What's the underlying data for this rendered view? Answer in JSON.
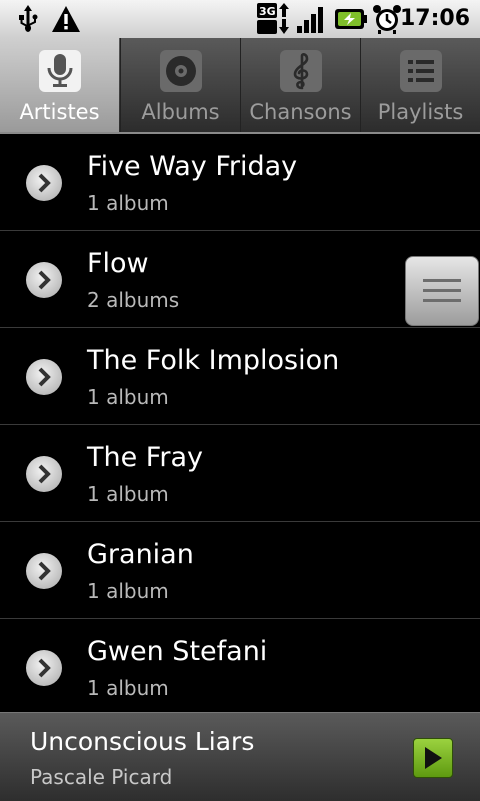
{
  "status_bar": {
    "time": "17:06",
    "network_label": "3G",
    "icons": [
      "usb-icon",
      "warning-icon",
      "3g-data-icon",
      "signal-icon",
      "battery-charging-icon",
      "alarm-clock-icon"
    ]
  },
  "tabs": [
    {
      "label": "Artistes",
      "icon": "microphone-icon",
      "active": true
    },
    {
      "label": "Albums",
      "icon": "album-disc-icon",
      "active": false
    },
    {
      "label": "Chansons",
      "icon": "treble-clef-icon",
      "active": false
    },
    {
      "label": "Playlists",
      "icon": "playlist-icon",
      "active": false
    }
  ],
  "artists": [
    {
      "name": "Five Way Friday",
      "albums": "1 album"
    },
    {
      "name": "Flow",
      "albums": "2 albums"
    },
    {
      "name": "The Folk Implosion",
      "albums": "1 album"
    },
    {
      "name": "The Fray",
      "albums": "1 album"
    },
    {
      "name": "Granian",
      "albums": "1 album"
    },
    {
      "name": "Gwen Stefani",
      "albums": "1 album"
    }
  ],
  "now_playing": {
    "title": "Unconscious Liars",
    "artist": "Pascale Picard"
  },
  "colors": {
    "accent_green": "#7fbf2a",
    "background": "#000000"
  }
}
